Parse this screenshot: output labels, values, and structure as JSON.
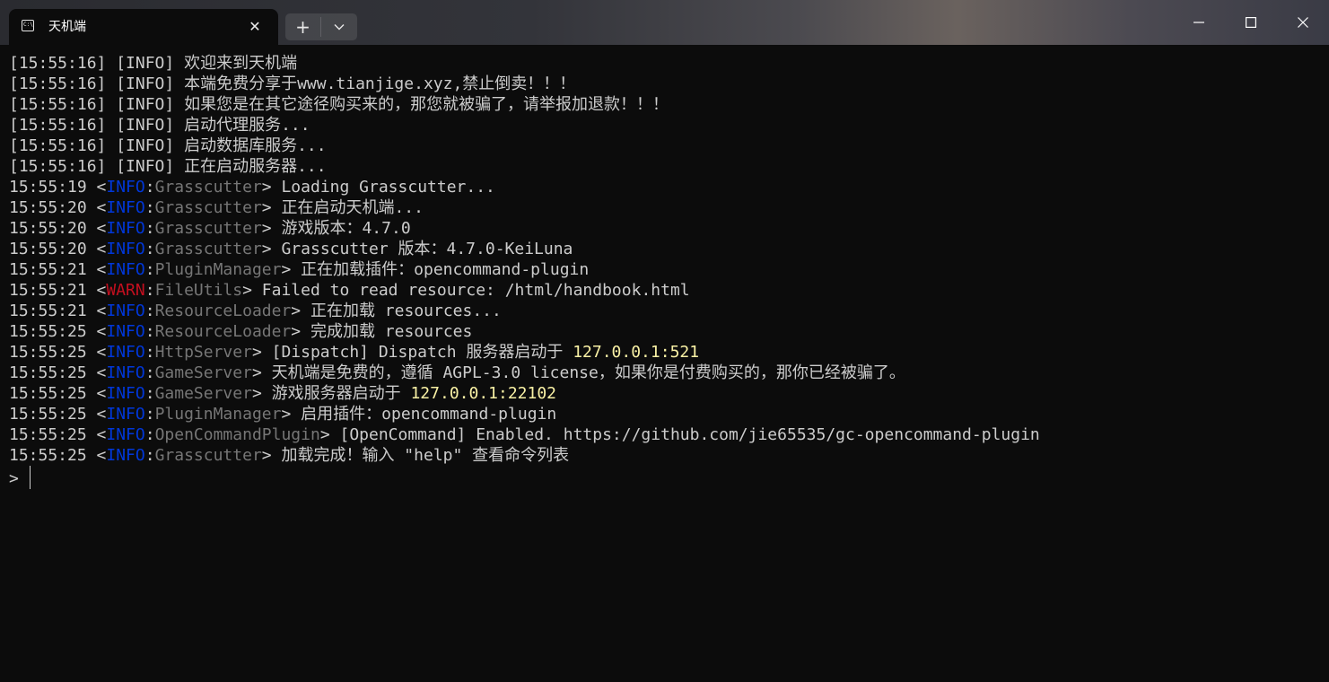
{
  "window": {
    "tab_title": "天机端",
    "tab_close": "✕",
    "new_tab": "+"
  },
  "colors": {
    "background": "#0c0c0c",
    "default_text": "#cccccc",
    "info_tag": "#0037da",
    "warn_tag": "#c50f1f",
    "logger_name": "#767676",
    "address": "#f9f1a5"
  },
  "terminal": {
    "lines": [
      {
        "segments": [
          {
            "text": "[15:55:16] [INFO] 欢迎来到天机端",
            "color": ""
          }
        ]
      },
      {
        "segments": [
          {
            "text": "[15:55:16] [INFO] 本端免费分享于www.tianjige.xyz,禁止倒卖！！！",
            "color": ""
          }
        ]
      },
      {
        "segments": [
          {
            "text": "[15:55:16] [INFO] 如果您是在其它途径购买来的，那您就被骗了，请举报加退款！！！",
            "color": ""
          }
        ]
      },
      {
        "segments": [
          {
            "text": "[15:55:16] [INFO] 启动代理服务...",
            "color": ""
          }
        ]
      },
      {
        "segments": [
          {
            "text": "[15:55:16] [INFO] 启动数据库服务...",
            "color": ""
          }
        ]
      },
      {
        "segments": [
          {
            "text": "[15:55:16] [INFO] 正在启动服务器...",
            "color": ""
          }
        ]
      },
      {
        "segments": [
          {
            "text": "15:55:19 <",
            "color": ""
          },
          {
            "text": "INFO",
            "color": "c-blue"
          },
          {
            "text": ":",
            "color": ""
          },
          {
            "text": "Grasscutter",
            "color": "c-gray"
          },
          {
            "text": "> Loading Grasscutter...",
            "color": ""
          }
        ]
      },
      {
        "segments": [
          {
            "text": "15:55:20 <",
            "color": ""
          },
          {
            "text": "INFO",
            "color": "c-blue"
          },
          {
            "text": ":",
            "color": ""
          },
          {
            "text": "Grasscutter",
            "color": "c-gray"
          },
          {
            "text": "> 正在启动天机端...",
            "color": ""
          }
        ]
      },
      {
        "segments": [
          {
            "text": "15:55:20 <",
            "color": ""
          },
          {
            "text": "INFO",
            "color": "c-blue"
          },
          {
            "text": ":",
            "color": ""
          },
          {
            "text": "Grasscutter",
            "color": "c-gray"
          },
          {
            "text": "> 游戏版本：4.7.0",
            "color": ""
          }
        ]
      },
      {
        "segments": [
          {
            "text": "15:55:20 <",
            "color": ""
          },
          {
            "text": "INFO",
            "color": "c-blue"
          },
          {
            "text": ":",
            "color": ""
          },
          {
            "text": "Grasscutter",
            "color": "c-gray"
          },
          {
            "text": "> Grasscutter 版本：4.7.0-KeiLuna",
            "color": ""
          }
        ]
      },
      {
        "segments": [
          {
            "text": "15:55:21 <",
            "color": ""
          },
          {
            "text": "INFO",
            "color": "c-blue"
          },
          {
            "text": ":",
            "color": ""
          },
          {
            "text": "PluginManager",
            "color": "c-gray"
          },
          {
            "text": "> 正在加载插件：opencommand-plugin",
            "color": ""
          }
        ]
      },
      {
        "segments": [
          {
            "text": "15:55:21 <",
            "color": ""
          },
          {
            "text": "WARN",
            "color": "c-red"
          },
          {
            "text": ":",
            "color": ""
          },
          {
            "text": "FileUtils",
            "color": "c-gray"
          },
          {
            "text": "> Failed to read resource: /html/handbook.html",
            "color": ""
          }
        ]
      },
      {
        "segments": [
          {
            "text": "15:55:21 <",
            "color": ""
          },
          {
            "text": "INFO",
            "color": "c-blue"
          },
          {
            "text": ":",
            "color": ""
          },
          {
            "text": "ResourceLoader",
            "color": "c-gray"
          },
          {
            "text": "> 正在加载 resources...",
            "color": ""
          }
        ]
      },
      {
        "segments": [
          {
            "text": "15:55:25 <",
            "color": ""
          },
          {
            "text": "INFO",
            "color": "c-blue"
          },
          {
            "text": ":",
            "color": ""
          },
          {
            "text": "ResourceLoader",
            "color": "c-gray"
          },
          {
            "text": "> 完成加载 resources",
            "color": ""
          }
        ]
      },
      {
        "segments": [
          {
            "text": "15:55:25 <",
            "color": ""
          },
          {
            "text": "INFO",
            "color": "c-blue"
          },
          {
            "text": ":",
            "color": ""
          },
          {
            "text": "HttpServer",
            "color": "c-gray"
          },
          {
            "text": "> [Dispatch] Dispatch 服务器启动于 ",
            "color": ""
          },
          {
            "text": "127.0.0.1:521",
            "color": "c-yellow"
          }
        ]
      },
      {
        "segments": [
          {
            "text": "15:55:25 <",
            "color": ""
          },
          {
            "text": "INFO",
            "color": "c-blue"
          },
          {
            "text": ":",
            "color": ""
          },
          {
            "text": "GameServer",
            "color": "c-gray"
          },
          {
            "text": "> 天机端是免费的，遵循 AGPL-3.0 license，如果你是付费购买的，那你已经被骗了。",
            "color": ""
          }
        ]
      },
      {
        "segments": [
          {
            "text": "15:55:25 <",
            "color": ""
          },
          {
            "text": "INFO",
            "color": "c-blue"
          },
          {
            "text": ":",
            "color": ""
          },
          {
            "text": "GameServer",
            "color": "c-gray"
          },
          {
            "text": "> 游戏服务器启动于 ",
            "color": ""
          },
          {
            "text": "127.0.0.1:22102",
            "color": "c-yellow"
          }
        ]
      },
      {
        "segments": [
          {
            "text": "15:55:25 <",
            "color": ""
          },
          {
            "text": "INFO",
            "color": "c-blue"
          },
          {
            "text": ":",
            "color": ""
          },
          {
            "text": "PluginManager",
            "color": "c-gray"
          },
          {
            "text": "> 启用插件：opencommand-plugin",
            "color": ""
          }
        ]
      },
      {
        "segments": [
          {
            "text": "15:55:25 <",
            "color": ""
          },
          {
            "text": "INFO",
            "color": "c-blue"
          },
          {
            "text": ":",
            "color": ""
          },
          {
            "text": "OpenCommandPlugin",
            "color": "c-gray"
          },
          {
            "text": "> [OpenCommand] Enabled. https://github.com/jie65535/gc-opencommand-plugin",
            "color": ""
          }
        ]
      },
      {
        "segments": [
          {
            "text": "15:55:25 <",
            "color": ""
          },
          {
            "text": "INFO",
            "color": "c-blue"
          },
          {
            "text": ":",
            "color": ""
          },
          {
            "text": "Grasscutter",
            "color": "c-gray"
          },
          {
            "text": "> 加载完成！输入 \"help\" 查看命令列表",
            "color": ""
          }
        ]
      }
    ],
    "prompt": "> "
  }
}
